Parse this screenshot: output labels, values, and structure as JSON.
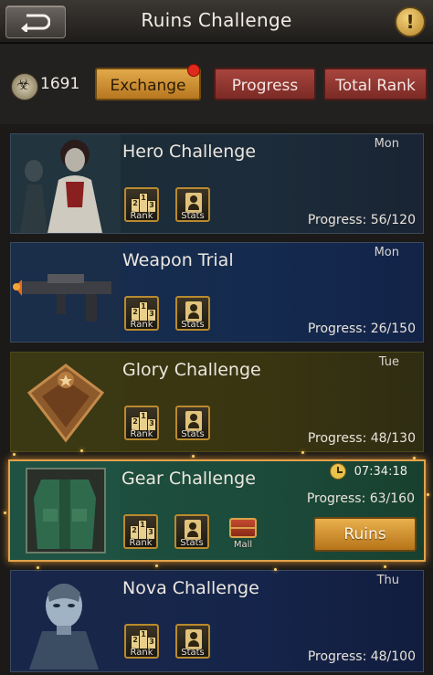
{
  "header": {
    "title": "Ruins Challenge",
    "back_icon": "return-arrow-icon",
    "info_label": "!"
  },
  "currency": {
    "value": "1691",
    "icon": "biohazard-coin-icon"
  },
  "tabs": [
    {
      "label": "Exchange",
      "has_notification": true
    },
    {
      "label": "Progress"
    },
    {
      "label": "Total Rank"
    }
  ],
  "mini_labels": {
    "rank": "Rank",
    "stats": "Stats",
    "mall": "Mall"
  },
  "challenges": [
    {
      "name": "Hero Challenge",
      "day": "Mon",
      "progress": "Progress: 56/120"
    },
    {
      "name": "Weapon Trial",
      "day": "Mon",
      "progress": "Progress: 26/150"
    },
    {
      "name": "Glory Challenge",
      "day": "Tue",
      "progress": "Progress: 48/130"
    },
    {
      "name": "Gear Challenge",
      "timer": "07:34:18",
      "progress": "Progress: 63/160",
      "action_label": "Ruins"
    },
    {
      "name": "Nova Challenge",
      "day": "Thu",
      "progress": "Progress: 48/100"
    }
  ],
  "colors": {
    "gold": "#e2a94a",
    "red_tab": "#a8453e",
    "active_border": "#e2a24b"
  }
}
